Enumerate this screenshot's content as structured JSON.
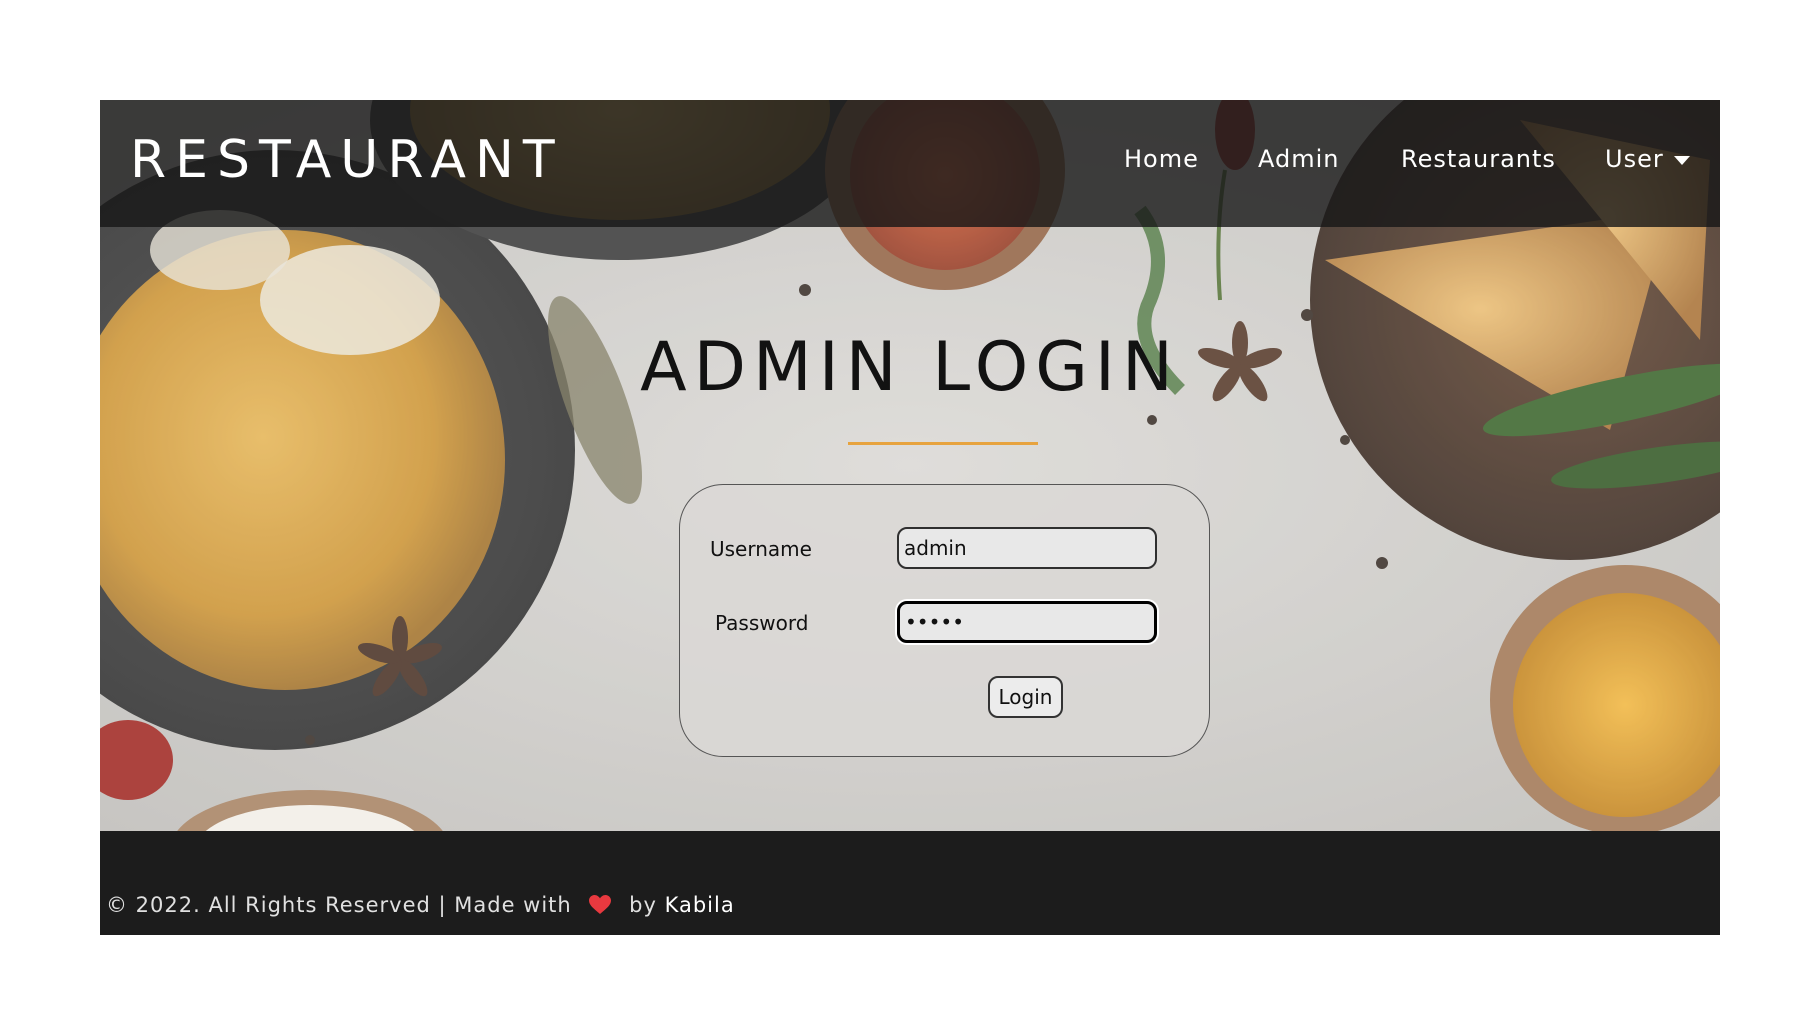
{
  "navbar": {
    "brand": "RESTAURANT",
    "links": {
      "home": "Home",
      "admin": "Admin",
      "restaurants": "Restaurants",
      "user": "User"
    }
  },
  "main": {
    "title": "ADMIN LOGIN",
    "accent_color": "#e7a33e",
    "form": {
      "username_label": "Username",
      "username_value": "admin",
      "password_label": "Password",
      "password_value": "•••••",
      "login_label": "Login"
    }
  },
  "footer": {
    "text_before": "© 2022. All Rights Reserved | Made with",
    "text_by": "by",
    "author": "Kabila",
    "heart_color": "#e8393f"
  },
  "background": {
    "description_icons": [
      "food-bowl-icon",
      "spice-bowl-icon",
      "samosa-icon",
      "chili-icon",
      "turmeric-bowl-icon",
      "star-anise-icon"
    ]
  }
}
